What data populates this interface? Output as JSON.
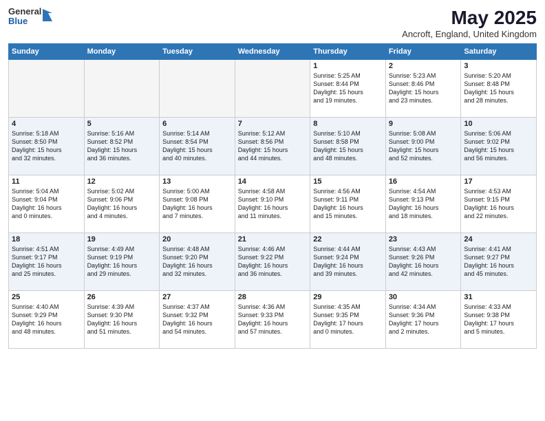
{
  "header": {
    "logo_general": "General",
    "logo_blue": "Blue",
    "title": "May 2025",
    "subtitle": "Ancroft, England, United Kingdom"
  },
  "days_of_week": [
    "Sunday",
    "Monday",
    "Tuesday",
    "Wednesday",
    "Thursday",
    "Friday",
    "Saturday"
  ],
  "weeks": [
    [
      {
        "day": "",
        "info": ""
      },
      {
        "day": "",
        "info": ""
      },
      {
        "day": "",
        "info": ""
      },
      {
        "day": "",
        "info": ""
      },
      {
        "day": "1",
        "info": "Sunrise: 5:25 AM\nSunset: 8:44 PM\nDaylight: 15 hours\nand 19 minutes."
      },
      {
        "day": "2",
        "info": "Sunrise: 5:23 AM\nSunset: 8:46 PM\nDaylight: 15 hours\nand 23 minutes."
      },
      {
        "day": "3",
        "info": "Sunrise: 5:20 AM\nSunset: 8:48 PM\nDaylight: 15 hours\nand 28 minutes."
      }
    ],
    [
      {
        "day": "4",
        "info": "Sunrise: 5:18 AM\nSunset: 8:50 PM\nDaylight: 15 hours\nand 32 minutes."
      },
      {
        "day": "5",
        "info": "Sunrise: 5:16 AM\nSunset: 8:52 PM\nDaylight: 15 hours\nand 36 minutes."
      },
      {
        "day": "6",
        "info": "Sunrise: 5:14 AM\nSunset: 8:54 PM\nDaylight: 15 hours\nand 40 minutes."
      },
      {
        "day": "7",
        "info": "Sunrise: 5:12 AM\nSunset: 8:56 PM\nDaylight: 15 hours\nand 44 minutes."
      },
      {
        "day": "8",
        "info": "Sunrise: 5:10 AM\nSunset: 8:58 PM\nDaylight: 15 hours\nand 48 minutes."
      },
      {
        "day": "9",
        "info": "Sunrise: 5:08 AM\nSunset: 9:00 PM\nDaylight: 15 hours\nand 52 minutes."
      },
      {
        "day": "10",
        "info": "Sunrise: 5:06 AM\nSunset: 9:02 PM\nDaylight: 15 hours\nand 56 minutes."
      }
    ],
    [
      {
        "day": "11",
        "info": "Sunrise: 5:04 AM\nSunset: 9:04 PM\nDaylight: 16 hours\nand 0 minutes."
      },
      {
        "day": "12",
        "info": "Sunrise: 5:02 AM\nSunset: 9:06 PM\nDaylight: 16 hours\nand 4 minutes."
      },
      {
        "day": "13",
        "info": "Sunrise: 5:00 AM\nSunset: 9:08 PM\nDaylight: 16 hours\nand 7 minutes."
      },
      {
        "day": "14",
        "info": "Sunrise: 4:58 AM\nSunset: 9:10 PM\nDaylight: 16 hours\nand 11 minutes."
      },
      {
        "day": "15",
        "info": "Sunrise: 4:56 AM\nSunset: 9:11 PM\nDaylight: 16 hours\nand 15 minutes."
      },
      {
        "day": "16",
        "info": "Sunrise: 4:54 AM\nSunset: 9:13 PM\nDaylight: 16 hours\nand 18 minutes."
      },
      {
        "day": "17",
        "info": "Sunrise: 4:53 AM\nSunset: 9:15 PM\nDaylight: 16 hours\nand 22 minutes."
      }
    ],
    [
      {
        "day": "18",
        "info": "Sunrise: 4:51 AM\nSunset: 9:17 PM\nDaylight: 16 hours\nand 25 minutes."
      },
      {
        "day": "19",
        "info": "Sunrise: 4:49 AM\nSunset: 9:19 PM\nDaylight: 16 hours\nand 29 minutes."
      },
      {
        "day": "20",
        "info": "Sunrise: 4:48 AM\nSunset: 9:20 PM\nDaylight: 16 hours\nand 32 minutes."
      },
      {
        "day": "21",
        "info": "Sunrise: 4:46 AM\nSunset: 9:22 PM\nDaylight: 16 hours\nand 36 minutes."
      },
      {
        "day": "22",
        "info": "Sunrise: 4:44 AM\nSunset: 9:24 PM\nDaylight: 16 hours\nand 39 minutes."
      },
      {
        "day": "23",
        "info": "Sunrise: 4:43 AM\nSunset: 9:26 PM\nDaylight: 16 hours\nand 42 minutes."
      },
      {
        "day": "24",
        "info": "Sunrise: 4:41 AM\nSunset: 9:27 PM\nDaylight: 16 hours\nand 45 minutes."
      }
    ],
    [
      {
        "day": "25",
        "info": "Sunrise: 4:40 AM\nSunset: 9:29 PM\nDaylight: 16 hours\nand 48 minutes."
      },
      {
        "day": "26",
        "info": "Sunrise: 4:39 AM\nSunset: 9:30 PM\nDaylight: 16 hours\nand 51 minutes."
      },
      {
        "day": "27",
        "info": "Sunrise: 4:37 AM\nSunset: 9:32 PM\nDaylight: 16 hours\nand 54 minutes."
      },
      {
        "day": "28",
        "info": "Sunrise: 4:36 AM\nSunset: 9:33 PM\nDaylight: 16 hours\nand 57 minutes."
      },
      {
        "day": "29",
        "info": "Sunrise: 4:35 AM\nSunset: 9:35 PM\nDaylight: 17 hours\nand 0 minutes."
      },
      {
        "day": "30",
        "info": "Sunrise: 4:34 AM\nSunset: 9:36 PM\nDaylight: 17 hours\nand 2 minutes."
      },
      {
        "day": "31",
        "info": "Sunrise: 4:33 AM\nSunset: 9:38 PM\nDaylight: 17 hours\nand 5 minutes."
      }
    ]
  ]
}
